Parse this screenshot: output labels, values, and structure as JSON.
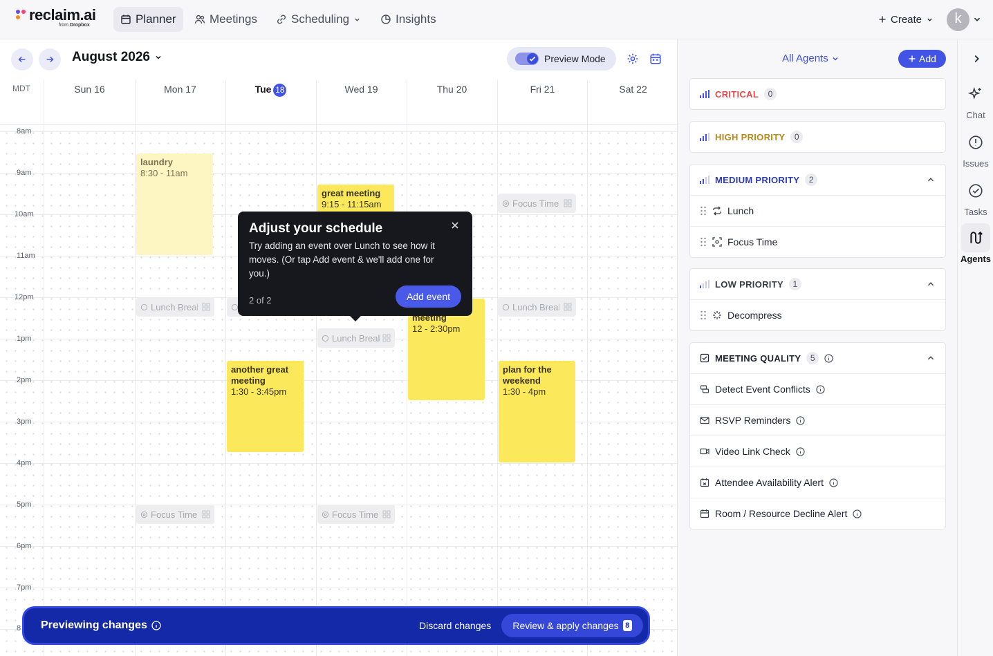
{
  "brand": {
    "name": "reclaim.ai",
    "sub_prefix": "from",
    "sub_brand": "Dropbox"
  },
  "nav": {
    "planner": "Planner",
    "meetings": "Meetings",
    "scheduling": "Scheduling",
    "insights": "Insights",
    "create": "Create",
    "avatar_initial": "k"
  },
  "calendar": {
    "month": "August 2026",
    "preview_mode": "Preview Mode",
    "timezone": "MDT",
    "days": [
      "Sun 16",
      "Mon 17",
      "Tue",
      "Wed 19",
      "Thu 20",
      "Fri 21",
      "Sat 22"
    ],
    "today_number": "18",
    "hours": [
      "8am",
      "9am",
      "10am",
      "11am",
      "12pm",
      "1pm",
      "2pm",
      "3pm",
      "4pm",
      "5pm",
      "6pm",
      "7pm",
      "8"
    ],
    "events": {
      "laundry": {
        "title": "laundry",
        "time": "8:30 - 11am"
      },
      "great_meeting": {
        "title": "great meeting",
        "time": "9:15 - 11:15am"
      },
      "meeting_thu": {
        "title": "meeting",
        "time": "12 - 2:30pm"
      },
      "another_meeting": {
        "title": "another great meeting",
        "time": "1:30 - 3:45pm"
      },
      "weekend": {
        "title": "plan for the weekend",
        "time": "1:30 - 4pm"
      }
    },
    "ghosts": {
      "focus": "Focus Time",
      "lunch": "Lunch Break"
    }
  },
  "tooltip": {
    "title": "Adjust your schedule",
    "body": "Try adding an event over Lunch to see how it moves. (Or tap Add event & we'll add one for you.)",
    "step": "2 of 2",
    "button": "Add event"
  },
  "preview_bar": {
    "title": "Previewing changes",
    "discard": "Discard changes",
    "review": "Review & apply changes",
    "count": "8"
  },
  "panel": {
    "agents": "All Agents",
    "add": "Add",
    "critical": {
      "label": "CRITICAL",
      "count": "0"
    },
    "high": {
      "label": "HIGH PRIORITY",
      "count": "0"
    },
    "medium": {
      "label": "MEDIUM PRIORITY",
      "count": "2",
      "items": [
        "Lunch",
        "Focus Time"
      ]
    },
    "low": {
      "label": "LOW PRIORITY",
      "count": "1",
      "items": [
        "Decompress"
      ]
    },
    "quality": {
      "label": "MEETING QUALITY",
      "count": "5",
      "items": [
        "Detect Event Conflicts",
        "RSVP Reminders",
        "Video Link Check",
        "Attendee Availability Alert",
        "Room / Resource Decline Alert"
      ]
    }
  },
  "rail": {
    "chat": "Chat",
    "issues": "Issues",
    "tasks": "Tasks",
    "agents": "Agents"
  },
  "colors": {
    "accent": "#4154e6",
    "critical": "#e0484a",
    "high": "#b8891b",
    "medium": "#2b3bb8",
    "event": "#fce85b",
    "preview_bar": "#1429a8"
  }
}
